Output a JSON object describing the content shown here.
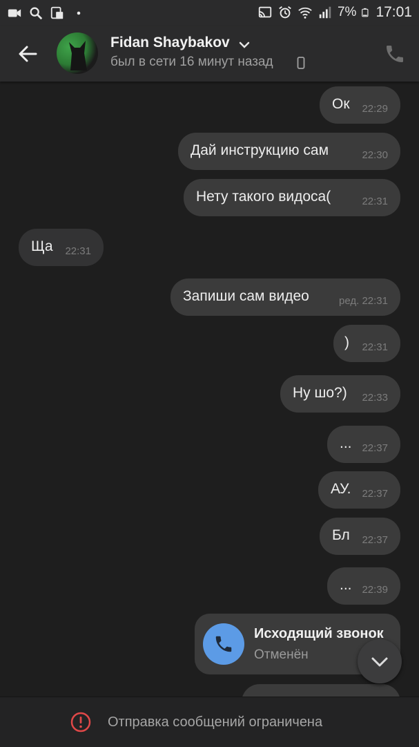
{
  "status_bar": {
    "left_icons": [
      "video-call-icon",
      "search-icon",
      "screenshot-icon",
      "dot-icon"
    ],
    "right_icons": [
      "cast-icon",
      "alarm-icon",
      "wifi-icon",
      "signal-icon",
      "battery-icon"
    ],
    "battery": "7%",
    "time": "17:01"
  },
  "header": {
    "contact_name": "Fidan Shaybakov",
    "status": "был в сети 16 минут назад"
  },
  "messages": [
    {
      "dir": "out",
      "text": "Ок",
      "time": "22:29"
    },
    {
      "dir": "out",
      "text": "Дай инструкцию сам",
      "time": "22:30"
    },
    {
      "dir": "out",
      "text": "Нету такого видоса(",
      "time": "22:31"
    },
    {
      "dir": "in",
      "text": "Ща",
      "time": "22:31"
    },
    {
      "dir": "out",
      "text": "Запиши сам видео",
      "time": "ред. 22:31"
    },
    {
      "dir": "out",
      "text": ")",
      "time": "22:31"
    },
    {
      "dir": "out",
      "text": "Ну шо?)",
      "time": "22:33"
    },
    {
      "dir": "out",
      "text": "...",
      "time": "22:37"
    },
    {
      "dir": "out",
      "text": "АУ.",
      "time": "22:37"
    },
    {
      "dir": "out",
      "text": "Бл",
      "time": "22:37"
    },
    {
      "dir": "out",
      "text": "...",
      "time": "22:39"
    }
  ],
  "call": {
    "title": "Исходящий звонок",
    "subtitle": "Отменён"
  },
  "bottom_bar": {
    "text": "Отправка сообщений ограничена"
  },
  "colors": {
    "background": "#1e1e1e",
    "bubble": "#3b3b3b",
    "call_accent": "#5c9be6",
    "warning": "#e04848"
  }
}
